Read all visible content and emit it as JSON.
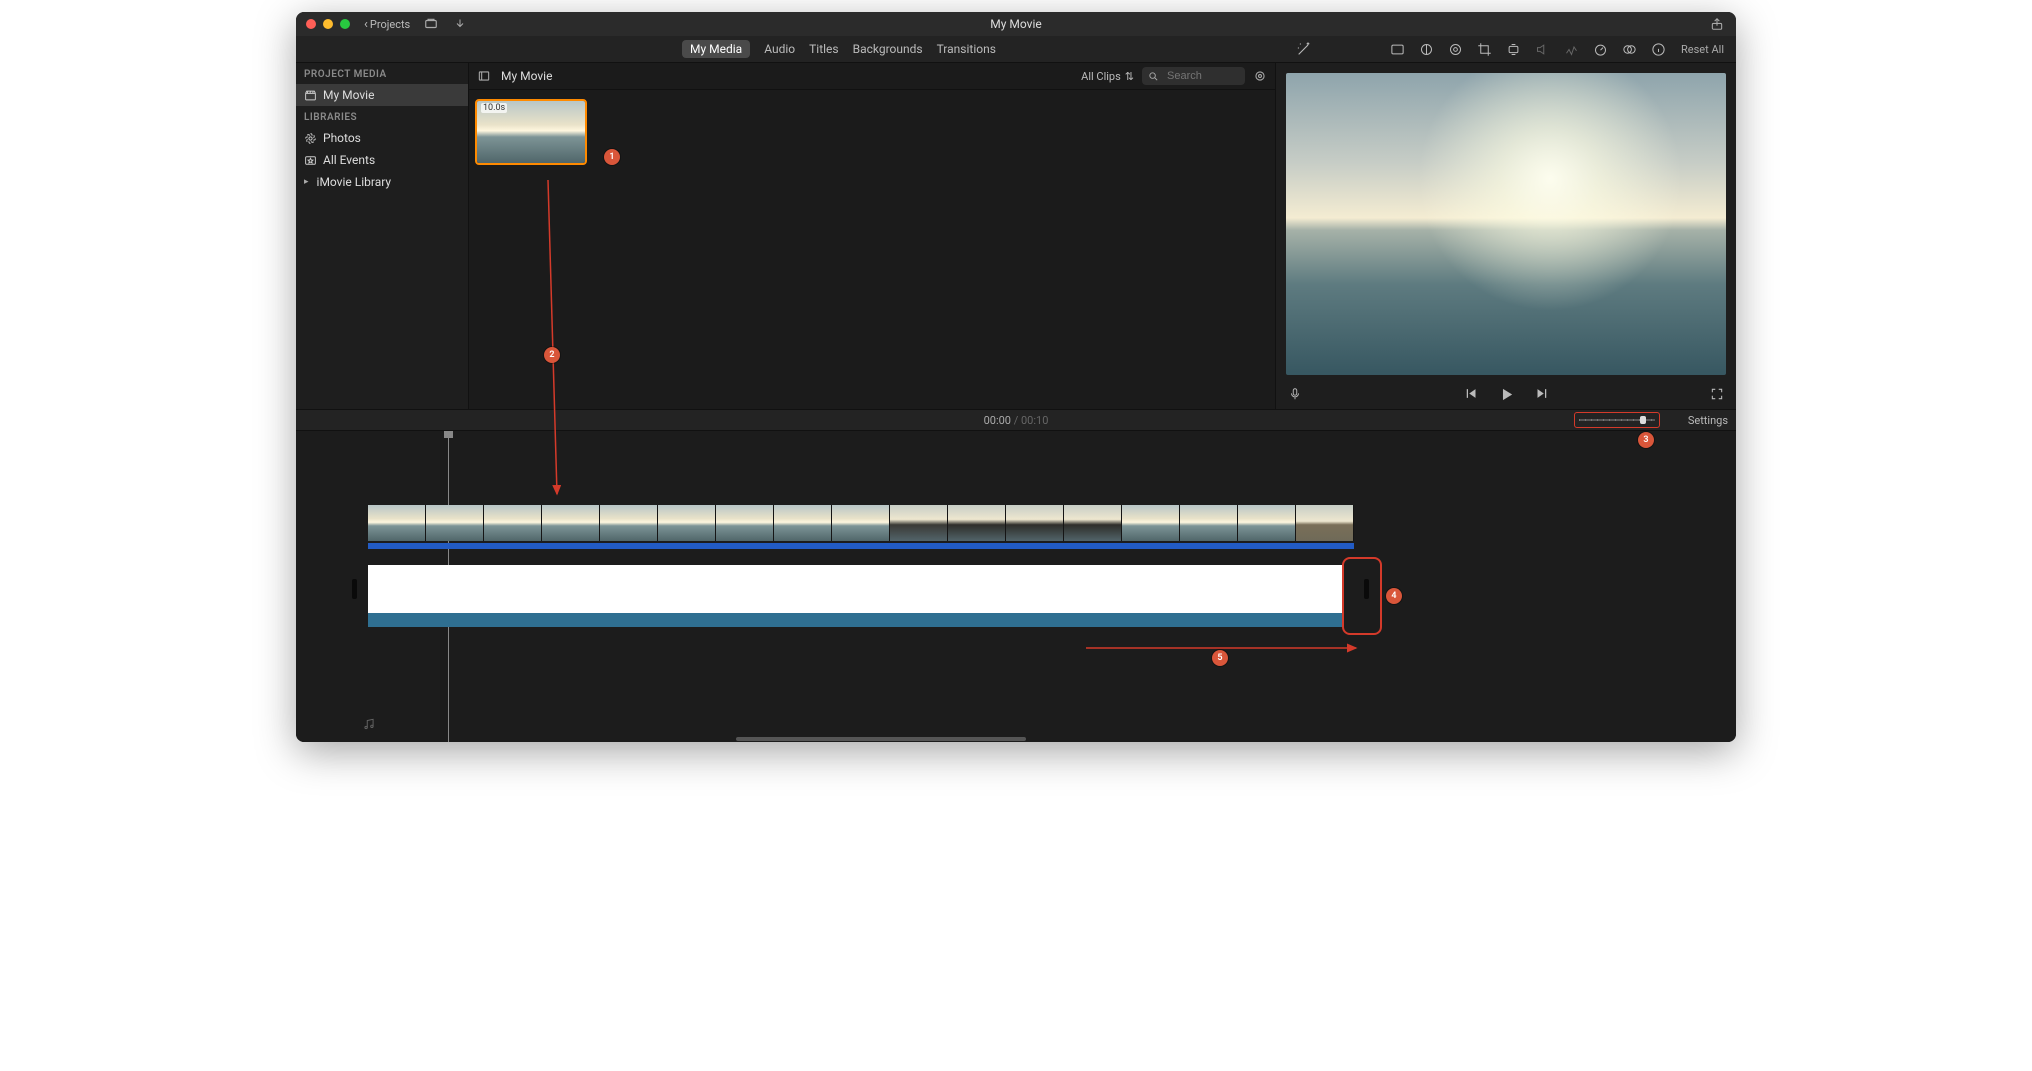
{
  "window": {
    "title": "My Movie"
  },
  "titlebar": {
    "projects_label": "Projects"
  },
  "tabs": {
    "my_media": "My Media",
    "audio": "Audio",
    "titles": "Titles",
    "backgrounds": "Backgrounds",
    "transitions": "Transitions"
  },
  "reset_all": "Reset All",
  "sidebar": {
    "project_media_label": "PROJECT MEDIA",
    "my_movie": "My Movie",
    "libraries_label": "LIBRARIES",
    "photos": "Photos",
    "all_events": "All Events",
    "imovie_library": "iMovie Library"
  },
  "browser": {
    "title": "My Movie",
    "filter_label": "All Clips",
    "search_placeholder": "Search",
    "clip_duration": "10.0s"
  },
  "timecode": {
    "current": "00:00",
    "total": "00:10",
    "separator": " / "
  },
  "settings_label": "Settings",
  "callouts": {
    "c1": "1",
    "c2": "2",
    "c3": "3",
    "c4": "4",
    "c5": "5"
  }
}
